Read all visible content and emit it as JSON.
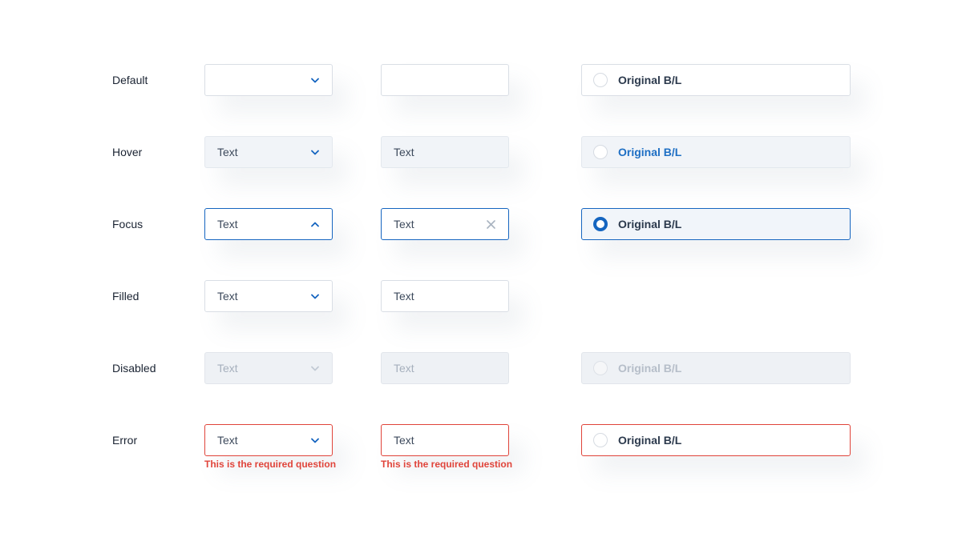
{
  "rows": {
    "default": {
      "label": "Default"
    },
    "hover": {
      "label": "Hover"
    },
    "focus": {
      "label": "Focus"
    },
    "filled": {
      "label": "Filled"
    },
    "disabled": {
      "label": "Disabled"
    },
    "error": {
      "label": "Error"
    }
  },
  "field_value": "Text",
  "radio_label": "Original B/L",
  "error_message": "This is the required question",
  "colors": {
    "accent": "#1565c0",
    "error": "#e0443a",
    "disabled_bg": "#eef1f5",
    "hover_bg": "#f1f4f8"
  },
  "icons": {
    "select": "chevron-down-icon",
    "select_open": "chevron-up-icon",
    "clear": "close-icon"
  }
}
